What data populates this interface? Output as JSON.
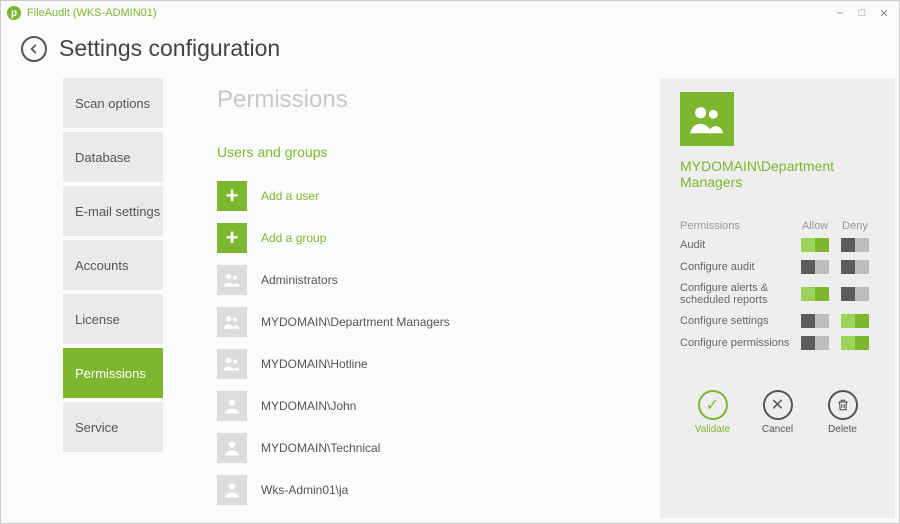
{
  "window": {
    "title": "FileAudit (WKS-ADMIN01)"
  },
  "header": {
    "page_title": "Settings configuration"
  },
  "sidebar": {
    "items": [
      {
        "label": "Scan options",
        "active": false
      },
      {
        "label": "Database",
        "active": false
      },
      {
        "label": "E-mail settings",
        "active": false
      },
      {
        "label": "Accounts",
        "active": false
      },
      {
        "label": "License",
        "active": false
      },
      {
        "label": "Permissions",
        "active": true
      },
      {
        "label": "Service",
        "active": false
      }
    ]
  },
  "main": {
    "title": "Permissions",
    "subtitle": "Users and groups",
    "add_user_label": "Add a user",
    "add_group_label": "Add a group",
    "entries": [
      {
        "label": "Administrators",
        "kind": "group"
      },
      {
        "label": "MYDOMAIN\\Department Managers",
        "kind": "group"
      },
      {
        "label": "MYDOMAIN\\Hotline",
        "kind": "group"
      },
      {
        "label": "MYDOMAIN\\John",
        "kind": "user"
      },
      {
        "label": "MYDOMAIN\\Technical",
        "kind": "user"
      },
      {
        "label": "Wks-Admin01\\ja",
        "kind": "user"
      }
    ]
  },
  "panel": {
    "title": "MYDOMAIN\\Department Managers",
    "columns": {
      "name": "Permissions",
      "allow": "Allow",
      "deny": "Deny"
    },
    "rows": [
      {
        "label": "Audit",
        "allow": true,
        "deny": false
      },
      {
        "label": "Configure audit",
        "allow": false,
        "deny": false
      },
      {
        "label": "Configure alerts & scheduled reports",
        "allow": true,
        "deny": false
      },
      {
        "label": "Configure settings",
        "allow": false,
        "deny": true
      },
      {
        "label": "Configure permissions",
        "allow": false,
        "deny": true
      }
    ],
    "actions": {
      "validate": "Validate",
      "cancel": "Cancel",
      "delete": "Delete"
    }
  }
}
